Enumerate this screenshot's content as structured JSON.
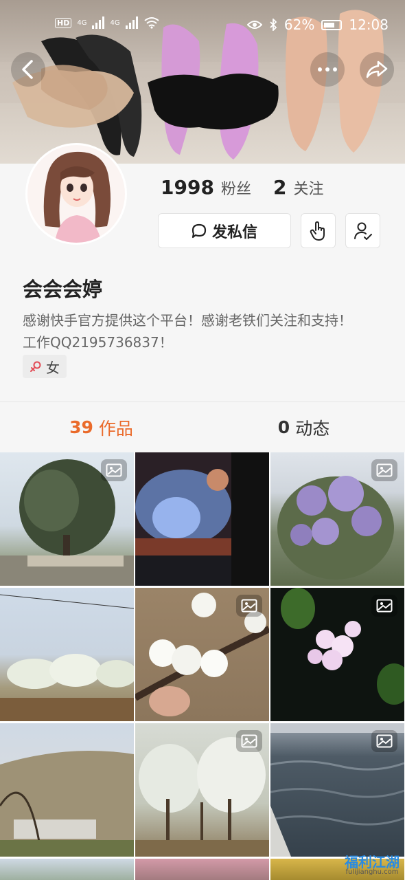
{
  "status_bar": {
    "left_labels": [
      "HD",
      "4G",
      "4G"
    ],
    "battery": "62%",
    "time": "12:08"
  },
  "profile": {
    "followers_count": "1998",
    "followers_label": "粉丝",
    "following_count": "2",
    "following_label": "关注",
    "message_button": "发私信",
    "name": "会会会婷",
    "bio_line1": "感谢快手官方提供这个平台！感谢老铁们关注和支持！",
    "bio_line2": "工作QQ2195736837！",
    "gender": "女"
  },
  "tabs": [
    {
      "count": "39",
      "label": "作品"
    },
    {
      "count": "0",
      "label": "动态"
    }
  ],
  "watermark": {
    "line1": "福利江湖",
    "line2": "fulijianghu.com"
  },
  "colors": {
    "accent": "#ea6a2a"
  },
  "icons": [
    "back-arrow-icon",
    "more-icon",
    "share-icon",
    "chat-bubble-icon",
    "hand-tap-icon",
    "user-check-icon",
    "female-icon",
    "image-icon"
  ]
}
